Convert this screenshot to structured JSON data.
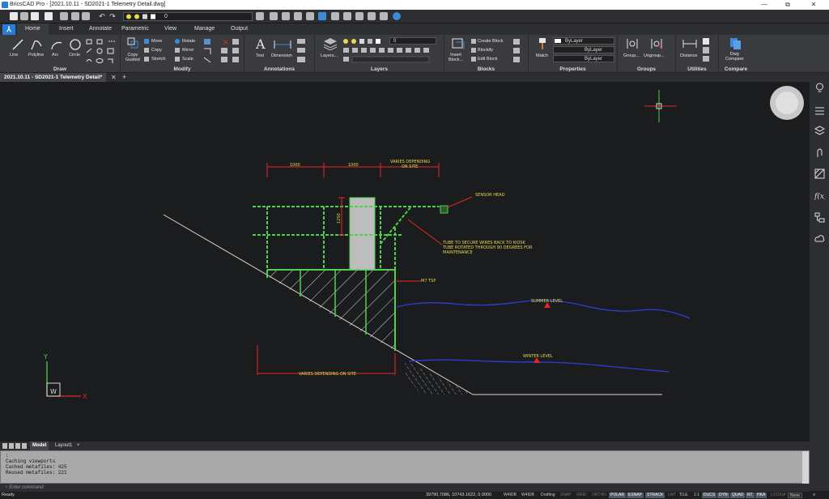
{
  "window": {
    "title": "BricsCAD Pro - [2021.10.11 - SD2021-1 Telemetry Detail.dwg]",
    "min": "—",
    "max": "⧉",
    "close": "✕"
  },
  "qat": {
    "layer_value": "0"
  },
  "tabs": [
    "Home",
    "Insert",
    "Annotate",
    "Parametric",
    "View",
    "Manage",
    "Output"
  ],
  "ribbon": {
    "panels": {
      "draw": "Draw",
      "modify": "Modify",
      "annotations": "Annotations",
      "layers": "Layers",
      "blocks": "Blocks",
      "properties": "Properties",
      "groups": "Groups",
      "utilities": "Utilities",
      "compare": "Compare"
    },
    "draw_tools": [
      "Line",
      "Polyline",
      "Arc",
      "Circle"
    ],
    "modify_tools": {
      "copy_guided": "Copy\nGuided",
      "move": "Move",
      "copy": "Copy",
      "stretch": "Stretch",
      "rotate": "Rotate",
      "mirror": "Mirror",
      "scale": "Scale"
    },
    "annotation_tools": [
      "Text",
      "Dimension"
    ],
    "layers_button": "Layers...",
    "layer_value": "0",
    "block_tools": {
      "insert_block": "Insert\nBlock...",
      "create_block": "Create Block",
      "blockify": "Blockify",
      "edit_block": "Edit Block"
    },
    "properties": {
      "match": "Match",
      "color": "ByLayer",
      "linetype": "ByLayer",
      "lineweight": "ByLayer"
    },
    "groups": [
      "Group...",
      "Ungroup..."
    ],
    "utilities": [
      "Distance"
    ],
    "compare": [
      "Dwg\nCompare"
    ]
  },
  "doc_tab": "2021.10.11 - SD2021-1 Telemetry Detail*",
  "drawing": {
    "dim_1000a": "1000",
    "dim_1000b": "1000",
    "dim_varies_top": "VARIES DEPENDING\nON SITE",
    "dim_1250": "1250",
    "sensor_head": "SENSOR HEAD",
    "tube_note": "TUBE TO SECURE WIRES BACK TO KIOSK\nTUBE ROTATED THROUGH 90 DEGREES FOR\nMAINTENANCE",
    "m7_tsp": "M7 TSP",
    "summer_level": "SUMMER  LEVEL",
    "winter_level": "WINTER  LEVEL",
    "dim_varies_bottom": "VARIES DEPENDING ON SITE",
    "ucs_y": "Y",
    "ucs_x": "X",
    "ucs_w": "W"
  },
  "layout_tabs": [
    "Model",
    "Layout1"
  ],
  "command_history": [
    "Caching viewports",
    "Cached metafiles: 425",
    "Reused metafiles: 221"
  ],
  "command_prompt": "Enter command",
  "status": {
    "ready": "Ready",
    "coords": "39790.7086, 10743.1622, 0.0000",
    "wcs": "W4IDB",
    "wcs2": "W4IDB",
    "workspace": "Drafting",
    "toggles": [
      "SNAP",
      "GRID",
      "ORTHO",
      "POLAR",
      "ESNAP",
      "STRACK",
      "LWT",
      "TILE",
      "1:1",
      "DUCS",
      "DYN",
      "QUAD",
      "RT",
      "HKA",
      "LOCKUI",
      "None"
    ]
  },
  "colors": {
    "green": "#4fd14f",
    "yellow": "#e8d84a",
    "red": "#e52626",
    "blue": "#2e3fd6",
    "white": "#d9d9d9"
  }
}
